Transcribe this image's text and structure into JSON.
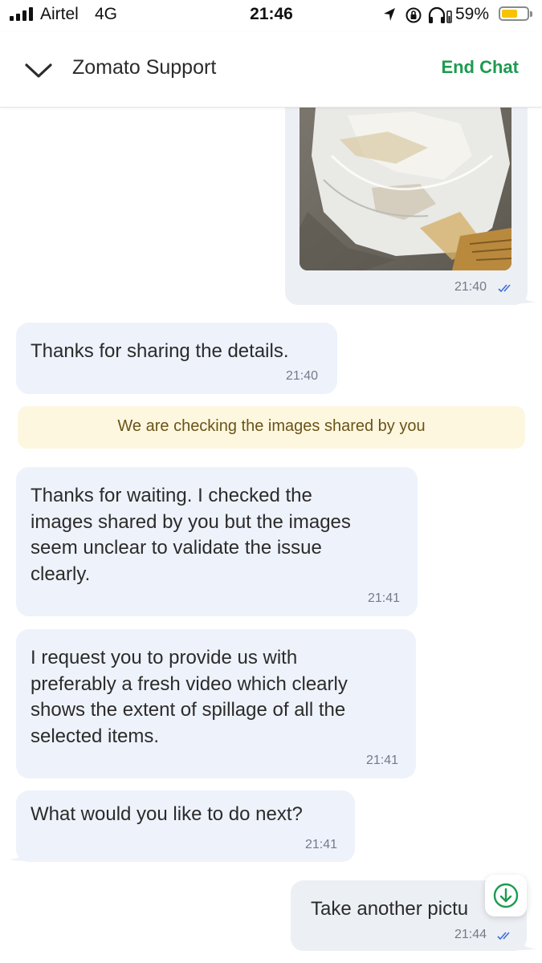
{
  "status_bar": {
    "carrier": "Airtel",
    "network": "4G",
    "time": "21:46",
    "battery_percent": "59%",
    "battery_level": 0.59,
    "icons": [
      "signal-bars-icon",
      "location-arrow-icon",
      "orientation-lock-icon",
      "headphones-icon",
      "battery-icon"
    ]
  },
  "header": {
    "title": "Zomato Support",
    "end_chat_label": "End Chat",
    "back_icon": "chevron-down-icon"
  },
  "colors": {
    "accent": "#1d9b4f",
    "incoming_bubble": "#eef2fb",
    "outgoing_bubble": "#eceff4",
    "notice_bg": "#fdf7e0",
    "notice_text": "#6b5318",
    "read_ticks": "#3b6fd8"
  },
  "messages": [
    {
      "direction": "out",
      "type": "image",
      "time": "21:40",
      "read": true
    },
    {
      "direction": "in",
      "type": "text",
      "text": "Thanks for sharing the details.",
      "time": "21:40"
    },
    {
      "direction": "system",
      "type": "notice",
      "text": "We are checking the images shared by you"
    },
    {
      "direction": "in",
      "type": "text",
      "text": "Thanks for waiting. I checked the\nimages shared by you but the images\nseem unclear to validate the issue\nclearly.",
      "time": "21:41"
    },
    {
      "direction": "in",
      "type": "text",
      "text": "I request you to provide us with\npreferably a fresh video which clearly\nshows the extent of spillage of all the\nselected items.",
      "time": "21:41"
    },
    {
      "direction": "in",
      "type": "text",
      "text": "What would you like to do next?",
      "time": "21:41"
    },
    {
      "direction": "out",
      "type": "text",
      "text": "Take another pictu",
      "time": "21:44",
      "read": true
    }
  ],
  "scroll_down_icon": "arrow-down-circle-icon"
}
